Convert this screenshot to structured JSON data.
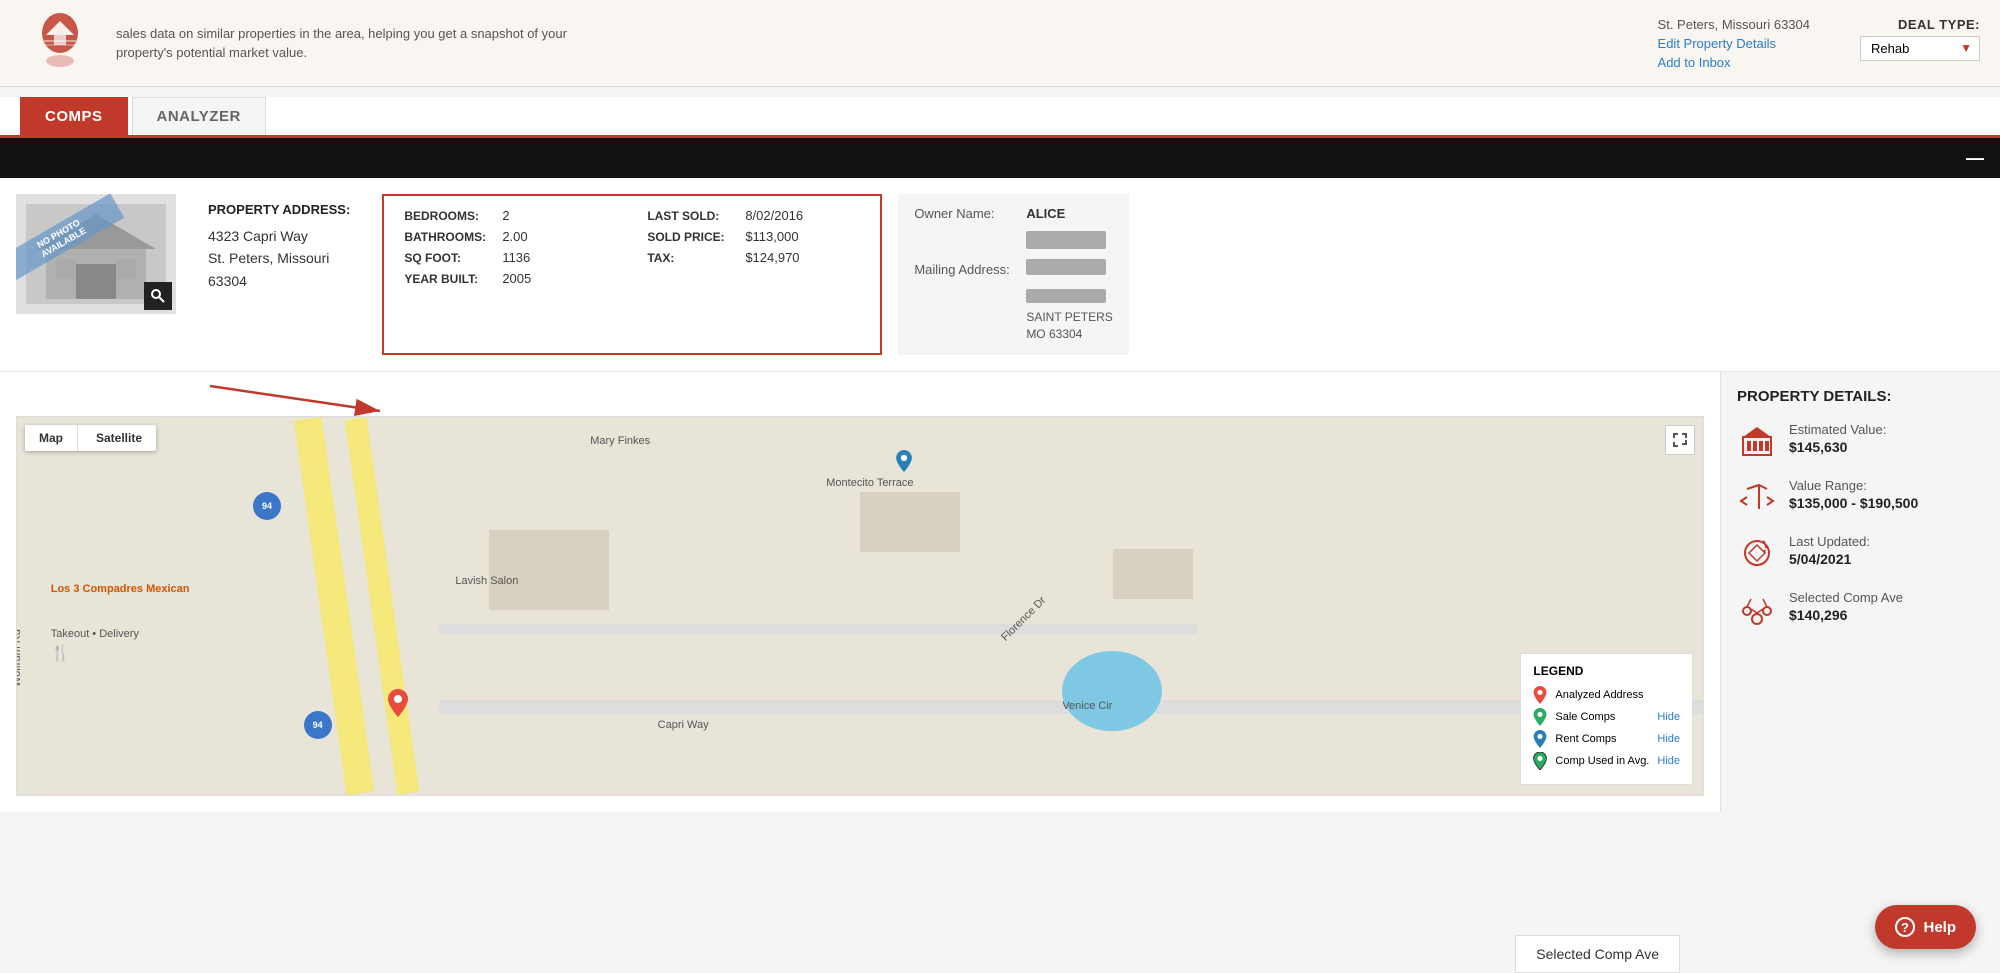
{
  "topbar": {
    "description": "sales data on similar properties in the area, helping you get a snapshot of your property's potential market value.",
    "address_line": "St. Peters, Missouri 63304",
    "edit_link": "Edit Property Details",
    "inbox_link": "Add to Inbox",
    "deal_type_label": "DEAL TYPE:",
    "deal_type_value": "Rehab"
  },
  "tabs": {
    "comps_label": "COMPS",
    "analyzer_label": "ANALYZER"
  },
  "property_bar": {
    "minimize": "—"
  },
  "property": {
    "no_photo": "NO PHOTO AVAILABLE",
    "address_label": "PROPERTY ADDRESS:",
    "address_line1": "4323 Capri Way",
    "address_line2": "St. Peters, Missouri",
    "address_line3": "63304",
    "bedrooms_label": "BEDROOMS:",
    "bedrooms_value": "2",
    "bathrooms_label": "BATHROOMS:",
    "bathrooms_value": "2.00",
    "sqfoot_label": "SQ FOOT:",
    "sqfoot_value": "1136",
    "yearbuilt_label": "YEAR BUILT:",
    "yearbuilt_value": "2005",
    "lastsold_label": "LAST SOLD:",
    "lastsold_value": "8/02/2016",
    "soldprice_label": "SOLD PRICE:",
    "soldprice_value": "$113,000",
    "tax_label": "TAX:",
    "tax_value": "$124,970",
    "owner_name_label": "Owner Name:",
    "owner_name_value": "ALICE",
    "mailing_address_label": "Mailing Address:",
    "mailing_city": "SAINT PETERS",
    "mailing_state_zip": "MO 63304"
  },
  "map": {
    "tab_map": "Map",
    "tab_satellite": "Satellite",
    "label_los3": "Los 3 Compadres\nMexican",
    "label_delivery": "Takeout • Delivery",
    "label_lavish": "Lavish Salon",
    "label_mary": "Mary Finkes",
    "label_montecito": "Montecito Terrace",
    "label_florence": "Florence Dr",
    "label_venice": "Venice Cir",
    "label_capri": "Capri Way",
    "legend_title": "LEGEND",
    "legend_analyzed": "Analyzed Address",
    "legend_sale_comps": "Sale Comps",
    "legend_rent_comps": "Rent Comps",
    "legend_comp_used": "Comp Used in Avg.",
    "hide_label": "Hide"
  },
  "property_details": {
    "title": "PROPERTY DETAILS:",
    "estimated_label": "Estimated Value:",
    "estimated_value": "$145,630",
    "value_range_label": "Value Range:",
    "value_range_value": "$135,000 - $190,500",
    "last_updated_label": "Last Updated:",
    "last_updated_value": "5/04/2021",
    "selected_comp_label": "Selected Comp Ave",
    "selected_comp_value": "$140,296"
  },
  "help_btn": "Help",
  "selected_comp_footer": "Selected Comp Ave"
}
